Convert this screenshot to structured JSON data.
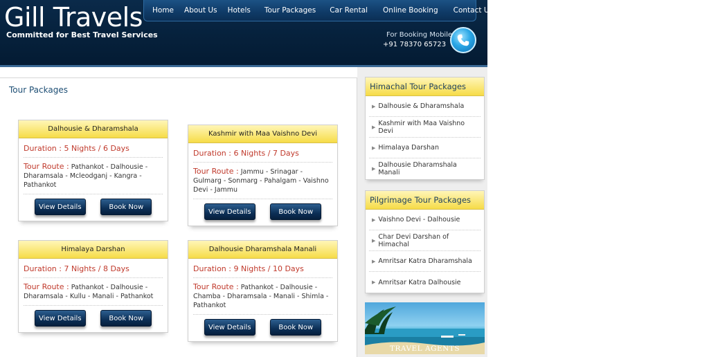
{
  "header": {
    "title": "Gill Travels",
    "tagline": "Committed for Best Travel Services",
    "booking_label": "For Booking Mobile",
    "booking_number": "+91 78370 65723"
  },
  "nav": {
    "items": [
      "Home",
      "About Us",
      "Hotels",
      "Tour Packages",
      "Car Rental",
      "Online Booking",
      "Contact Us"
    ]
  },
  "main": {
    "title": "Tour Packages",
    "route_label": "Tour Route :",
    "buttons": {
      "details": "View Details",
      "book": "Book Now"
    },
    "packages": [
      {
        "name": "Dalhousie & Dharamshala",
        "duration": "Duration : 5 Nights / 6 Days",
        "route": "Pathankot - Dalhousie - Dharamsala - Mcleodganj - Kangra - Pathankot"
      },
      {
        "name": "Kashmir with Maa Vaishno Devi",
        "duration": "Duration : 6 Nights / 7 Days",
        "route": "Jammu - Srinagar - Gulmarg - Sonmarg - Pahalgam - Vaishno Devi - Jammu"
      },
      {
        "name": "Himalaya Darshan",
        "duration": "Duration : 7 Nights / 8 Days",
        "route": "Pathankot - Dalhousie - Dharamsala - Kullu - Manali - Pathankot"
      },
      {
        "name": "Dalhousie Dharamshala Manali",
        "duration": "Duration : 9 Nights / 10 Days",
        "route": "Pathankot - Dalhousie - Chamba - Dharamsala - Manali - Shimla - Pathankot"
      }
    ]
  },
  "sidebar": {
    "himachal": {
      "title": "Himachal Tour Packages",
      "items": [
        "Dalhousie & Dharamshala",
        "Kashmir with Maa Vaishno Devi",
        "Himalaya Darshan",
        "Dalhousie Dharamshala Manali"
      ]
    },
    "pilgrimage": {
      "title": "Pilgrimage Tour Packages",
      "items": [
        "Vaishno Devi - Dalhousie",
        "Char Devi Darshan of Himachal",
        "Amritsar Katra Dharamshala",
        "Amritsar Katra Dalhousie"
      ]
    },
    "promo": {
      "caption": "TRAVEL AGENTS"
    }
  }
}
